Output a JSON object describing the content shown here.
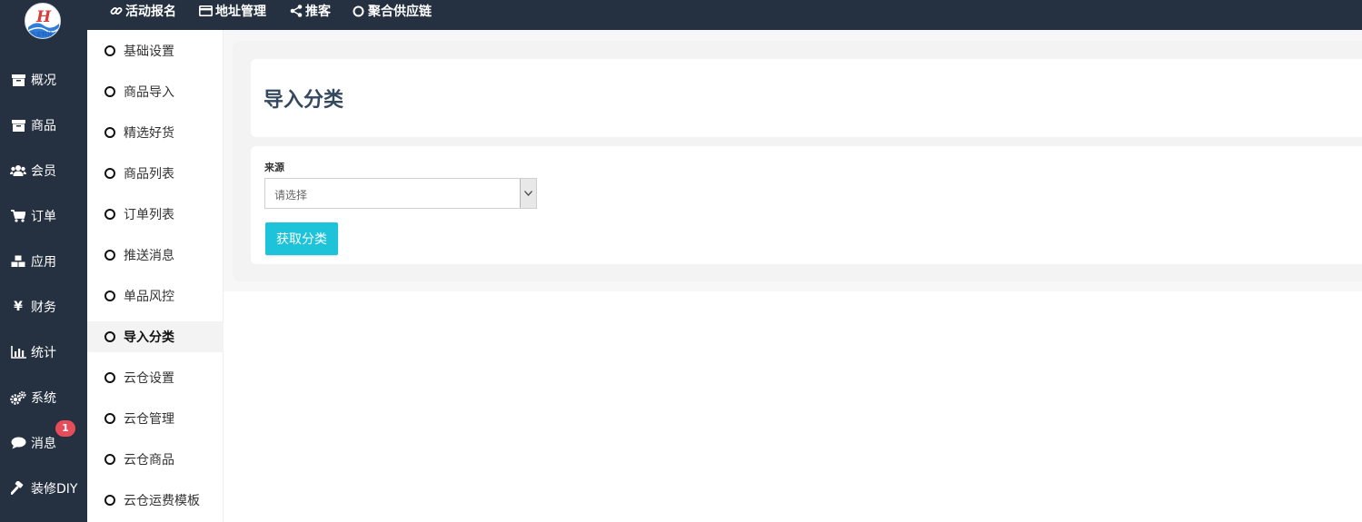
{
  "logo": {
    "text": "弘宏科技",
    "mark": "H"
  },
  "sidebar": {
    "items": [
      {
        "label": "概况",
        "icon": "archive-icon"
      },
      {
        "label": "商品",
        "icon": "archive-icon"
      },
      {
        "label": "会员",
        "icon": "users-icon"
      },
      {
        "label": "订单",
        "icon": "cart-icon"
      },
      {
        "label": "应用",
        "icon": "cubes-icon"
      },
      {
        "label": "财务",
        "icon": "yen-icon"
      },
      {
        "label": "统计",
        "icon": "bar-chart-icon"
      },
      {
        "label": "系统",
        "icon": "gears-icon"
      },
      {
        "label": "消息",
        "icon": "comment-icon",
        "badge": "1"
      },
      {
        "label": "装修DIY",
        "icon": "gavel-icon"
      }
    ]
  },
  "topbar": {
    "items": [
      {
        "label": "活动报名",
        "icon": "link-icon"
      },
      {
        "label": "地址管理",
        "icon": "credit-card-icon"
      },
      {
        "label": "推客",
        "icon": "share-icon"
      },
      {
        "label": "聚合供应链",
        "icon": "circle-icon"
      }
    ]
  },
  "subnav": {
    "items": [
      {
        "label": "基础设置"
      },
      {
        "label": "商品导入"
      },
      {
        "label": "精选好货"
      },
      {
        "label": "商品列表"
      },
      {
        "label": "订单列表"
      },
      {
        "label": "推送消息"
      },
      {
        "label": "单品风控"
      },
      {
        "label": "导入分类",
        "active": true
      },
      {
        "label": "云仓设置"
      },
      {
        "label": "云仓管理"
      },
      {
        "label": "云仓商品"
      },
      {
        "label": "云仓运费模板"
      }
    ]
  },
  "main": {
    "title": "导入分类",
    "source_label": "来源",
    "source_select": {
      "value": "请选择"
    },
    "submit_label": "获取分类"
  },
  "colors": {
    "sidebar_bg": "#253041",
    "accent_button": "#1cc3d9",
    "badge": "#e74c5a",
    "title": "#34495e"
  }
}
